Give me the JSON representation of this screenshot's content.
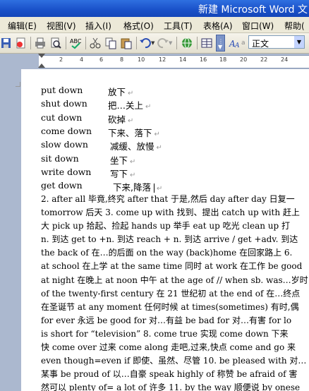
{
  "window": {
    "title": "新建 Microsoft Word 文"
  },
  "menu": [
    "编辑(E)",
    "视图(V)",
    "插入(I)",
    "格式(O)",
    "工具(T)",
    "表格(A)",
    "窗口(W)",
    "帮助("
  ],
  "toolbar": {
    "style_value": "正文",
    "icons": [
      "save-icon",
      "permission-icon",
      "print-icon",
      "print-preview-icon",
      "spelling-icon",
      "cut-icon",
      "copy-icon",
      "paste-icon",
      "undo-icon",
      "redo-icon",
      "hyperlink-icon",
      "tables-icon",
      "columns-icon",
      "show-hide-icon"
    ]
  },
  "ruler": {
    "numbers": [
      "2",
      "4",
      "6",
      "8",
      "10",
      "12",
      "14",
      "16",
      "18",
      "20",
      "22",
      "24"
    ]
  },
  "document": {
    "word_list": [
      {
        "en": "put down",
        "zh": "放下"
      },
      {
        "en": "shut down",
        "zh": "把…关上"
      },
      {
        "en": "cut down",
        "zh": "砍掉"
      },
      {
        "en": "come down",
        "zh": "下来、落下"
      },
      {
        "en": "slow down",
        "zh": "减缓、放慢"
      },
      {
        "en": "sit down",
        "zh": "坐下"
      },
      {
        "en": "write down",
        "zh": "写下"
      },
      {
        "en": "get down",
        "zh": "下来,降落"
      }
    ],
    "paragraph_lines": [
      "2. after all 毕竟,终究 after that 于是,然后 day after day 日复一",
      "tomorrow 后天 3. come up with 找到、提出 catch up with 赶上",
      "大 pick up 拾起、捡起 hands up 举手 eat up 吃光 clean up 打",
      "n. 到达 get to +n. 到达 reach + n. 到达 arrive / get +adv. 到达",
      "the back of 在…的后面 on the way (back)home 在回家路上 6.",
      "at school 在上学 at the same time 同时 at work 在工作 be good",
      "at night 在晚上 at noon 中午 at the age of // when sb. was…岁时",
      "of the twenty-first century 在 21 世纪初 at the end of 在…终点",
      "在圣诞节 at any moment 任何时候 at times(sometimes) 有时,偶",
      "for ever 永远 be good for 对…有益 be bad for 对…有害 for lo",
      "is short for “television” 8. come true 实现 come down 下来",
      "快 come over 过来 come along 走吧,过来,快点 come and go 来",
      "even though=even if 即使、虽然、尽管 10. be pleased with 对…",
      "某事 be proud of 以…自豪 speak highly of 称赞 be afraid of 害",
      "然可以 plenty of= a lot of 许多 11. by the way 顺便说 by onese"
    ]
  }
}
